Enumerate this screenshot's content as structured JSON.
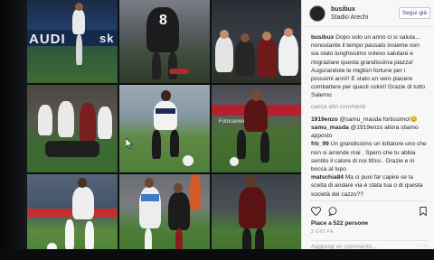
{
  "post": {
    "username": "busibux",
    "location": "Stadio Arechi",
    "follow_label": "Segui già",
    "caption_user": "busibux",
    "caption_text": "Dopo solo un anno ci si saluta… nonostante il tempo passato insieme non sia stato lunghissimo volevo salutare e ringraziare questa grandissima piazza! Augurandole le migliori fortune per i prossimi anni!! E stato un vero piacere combattere per questi colori! Grazie di tutto Salerno",
    "load_more": "carica altri commenti",
    "comments": [
      {
        "user": "1919enzo",
        "text": "@samu_masda fortissimo!😊"
      },
      {
        "user": "samu_masda",
        "text": "@1919enzo allora stiamo apposto"
      },
      {
        "user": "frb_99",
        "text": "Un grandissimo un lottatore uno che non si arrende mai . Spero che tu abbia sentito il calore di noi tifosi . Grazie e in bocca al lupo"
      },
      {
        "user": "matschia84",
        "text": "Ma ci puoi far capire se la scelta di andare via è stata tua o di questa società del cazzo??"
      }
    ],
    "likes": "Piace a 522 persone",
    "date": "2 GIO FA",
    "add_comment_placeholder": "Aggiungi un commento...",
    "more_options": "···"
  },
  "grid": {
    "tiles": [
      {
        "ad": "AUDI",
        "ad2": "sk"
      },
      {
        "number": "8"
      },
      {},
      {},
      {},
      {
        "small_ad": "Fotocamera Lucana"
      },
      {},
      {},
      {}
    ]
  },
  "icons": [
    "heart-icon",
    "comment-icon",
    "bookmark-icon"
  ]
}
